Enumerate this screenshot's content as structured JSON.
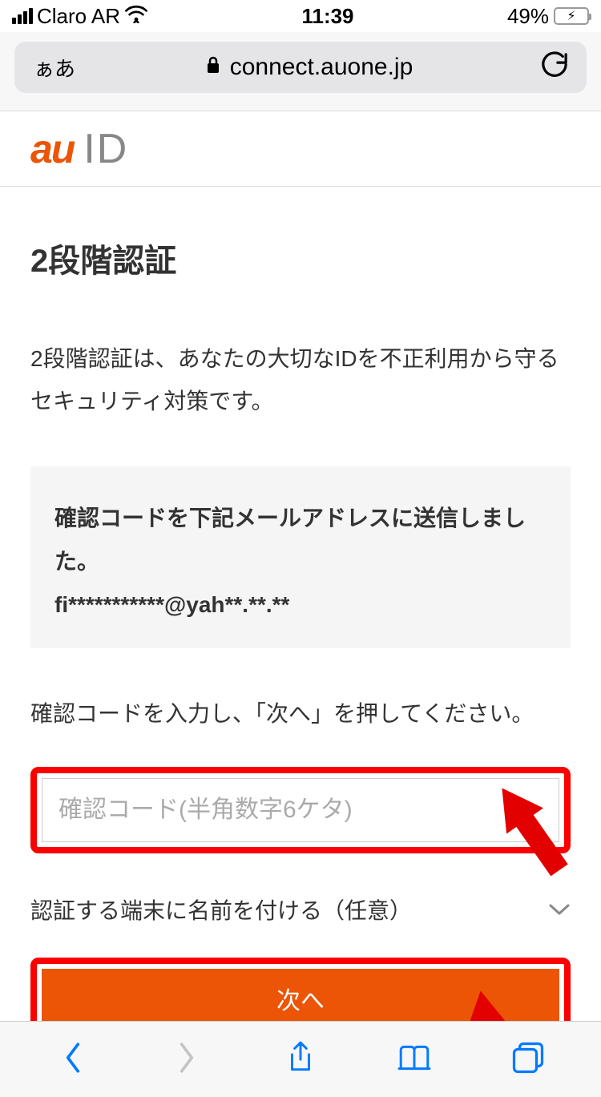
{
  "status": {
    "carrier": "Claro AR",
    "time": "11:39",
    "battery_pct": "49%"
  },
  "browser": {
    "reader": "ぁあ",
    "domain": "connect.auone.jp"
  },
  "header": {
    "logo": "au",
    "id": "ID"
  },
  "page": {
    "title": "2段階認証",
    "description": "2段階認証は、あなたの大切なIDを不正利用から守るセキュリティ対策です。",
    "info_box_text": "確認コードを下記メールアドレスに送信しました。",
    "info_box_email": "fi***********@yah**.**.**",
    "instruction": "確認コードを入力し、「次へ」を押してください。",
    "code_placeholder": "確認コード(半角数字6ケタ)",
    "expand_label": "認証する端末に名前を付ける（任意）",
    "next_button": "次へ"
  }
}
